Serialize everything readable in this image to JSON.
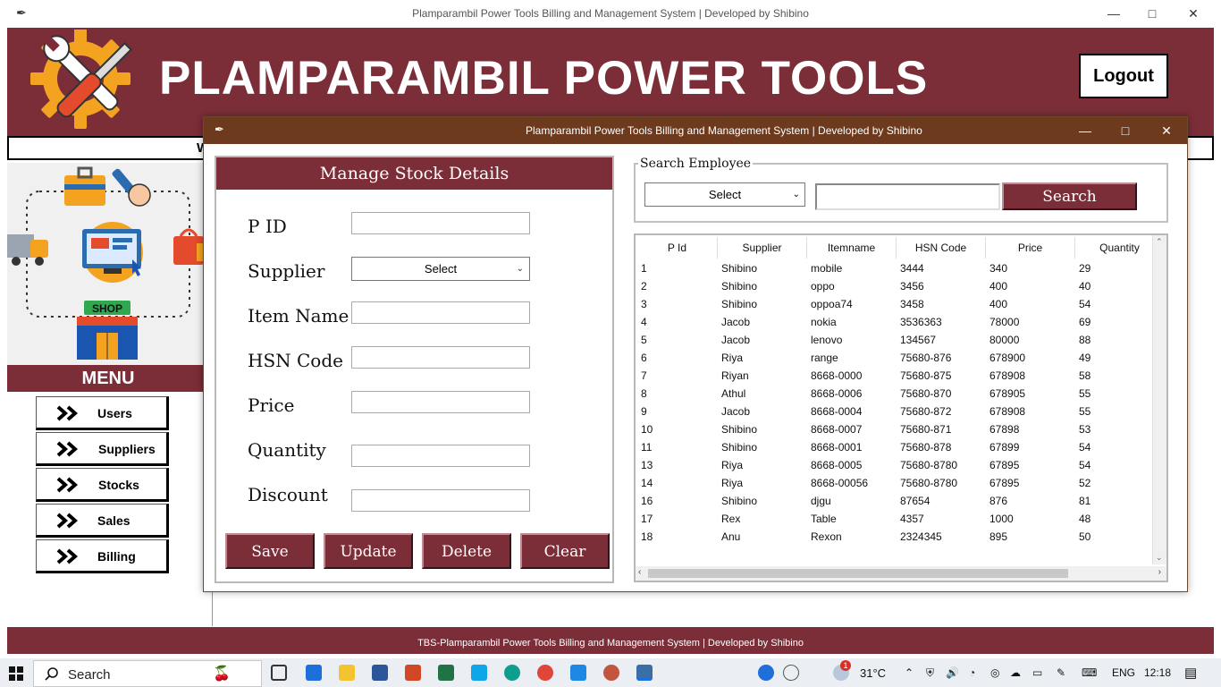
{
  "main_window": {
    "title": "Plamparambil Power Tools Billing and Management System |  Developed by Shibino",
    "brand": "PLAMPARAMBIL POWER TOOLS",
    "logout_label": "Logout",
    "welcome_visible_text": "W",
    "menu_header": "MENU",
    "menu_items": [
      {
        "label": "Users"
      },
      {
        "label": "Suppliers"
      },
      {
        "label": "Stocks"
      },
      {
        "label": "Sales"
      },
      {
        "label": "Billing"
      }
    ],
    "shop_sign": "SHOP",
    "footer_text": "TBS-Plamparambil Power Tools Billing and Management System |  Developed by Shibino"
  },
  "dialog": {
    "title": "Plamparambil Power Tools Billing and Management System |  Developed by Shibino",
    "form": {
      "heading": "Manage Stock Details",
      "labels": {
        "pid": "P ID",
        "supplier": "Supplier",
        "item_name": "Item Name",
        "hsn_code": "HSN Code",
        "price": "Price",
        "quantity": "Quantity",
        "discount": "Discount"
      },
      "values": {
        "pid": "",
        "supplier": "Select",
        "item_name": "",
        "hsn_code": "",
        "price": "",
        "quantity": "",
        "discount": ""
      },
      "buttons": {
        "save": "Save",
        "update": "Update",
        "delete": "Delete",
        "clear": "Clear"
      }
    },
    "search": {
      "legend": "Search Employee",
      "select_value": "Select",
      "input_value": "",
      "button_label": "Search"
    },
    "table": {
      "columns": [
        "P Id",
        "Supplier",
        "Itemname",
        "HSN Code",
        "Price",
        "Quantity"
      ],
      "rows": [
        [
          "1",
          "Shibino",
          "mobile",
          "3444",
          "340",
          "29"
        ],
        [
          "2",
          "Shibino",
          "oppo",
          "3456",
          "400",
          "40"
        ],
        [
          "3",
          "Shibino",
          "oppoa74",
          "3458",
          "400",
          "54"
        ],
        [
          "4",
          "Jacob",
          "nokia",
          "3536363",
          "78000",
          "69"
        ],
        [
          "5",
          "Jacob",
          "lenovo",
          "134567",
          "80000",
          "88"
        ],
        [
          "6",
          "Riya",
          "range",
          "75680-876",
          "678900",
          "49"
        ],
        [
          "7",
          "Riyan",
          "8668-0000",
          "75680-875",
          "678908",
          "58"
        ],
        [
          "8",
          "Athul",
          "8668-0006",
          "75680-870",
          "678905",
          "55"
        ],
        [
          "9",
          "Jacob",
          "8668-0004",
          "75680-872",
          "678908",
          "55"
        ],
        [
          "10",
          "Shibino",
          "8668-0007",
          "75680-871",
          "67898",
          "53"
        ],
        [
          "11",
          "Shibino",
          "8668-0001",
          "75680-878",
          "67899",
          "54"
        ],
        [
          "13",
          "Riya",
          "8668-0005",
          "75680-8780",
          "67895",
          "54"
        ],
        [
          "14",
          "Riya",
          "8668-00056",
          "75680-8780",
          "67895",
          "52"
        ],
        [
          "16",
          "Shibino",
          "djgu",
          "87654",
          "876",
          "81"
        ],
        [
          "17",
          "Rex",
          "Table",
          "4357",
          "1000",
          "48"
        ],
        [
          "18",
          "Anu",
          "Rexon",
          "2324345",
          "895",
          "50"
        ]
      ]
    }
  },
  "taskbar": {
    "search_label": "Search",
    "weather": "31°C",
    "language": "ENG",
    "time": "12:18",
    "weather_badge": "1"
  },
  "colors": {
    "brand_maroon": "#7b2d38",
    "dialog_titlebar": "#6e3a1e",
    "taskbar": "#ebeef2"
  }
}
